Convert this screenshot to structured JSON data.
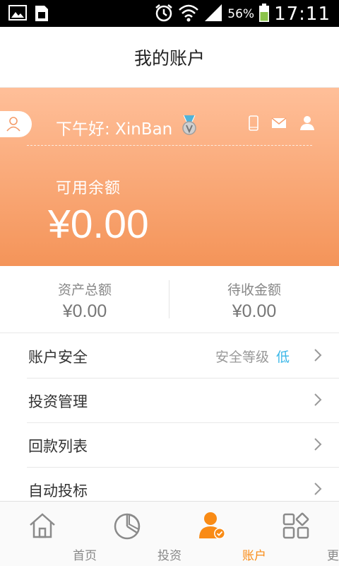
{
  "status_bar": {
    "battery": "56%",
    "time": "17:11"
  },
  "header": {
    "title": "我的账户"
  },
  "banner": {
    "greeting": "下午好: XinBan",
    "available_label": "可用余额",
    "available_value": "¥0.00"
  },
  "totals": {
    "assets_label": "资产总额",
    "assets_value": "¥0.00",
    "pending_label": "待收金额",
    "pending_value": "¥0.00"
  },
  "menu": {
    "items": [
      {
        "label": "账户安全",
        "hint": "安全等级",
        "level": "低"
      },
      {
        "label": "投资管理"
      },
      {
        "label": "回款列表"
      },
      {
        "label": "自动投标"
      }
    ]
  },
  "bottom_nav": {
    "items": [
      {
        "label": "首页",
        "icon": "home-icon"
      },
      {
        "label": "投资",
        "icon": "pie-chart-icon"
      },
      {
        "label": "账户",
        "icon": "account-icon",
        "active": true
      },
      {
        "label": "更多",
        "icon": "grid-icon"
      }
    ]
  },
  "colors": {
    "accent": "#f98b15",
    "banner_top": "#ffbf99",
    "banner_bottom": "#f49459",
    "link": "#3ab7e8"
  }
}
